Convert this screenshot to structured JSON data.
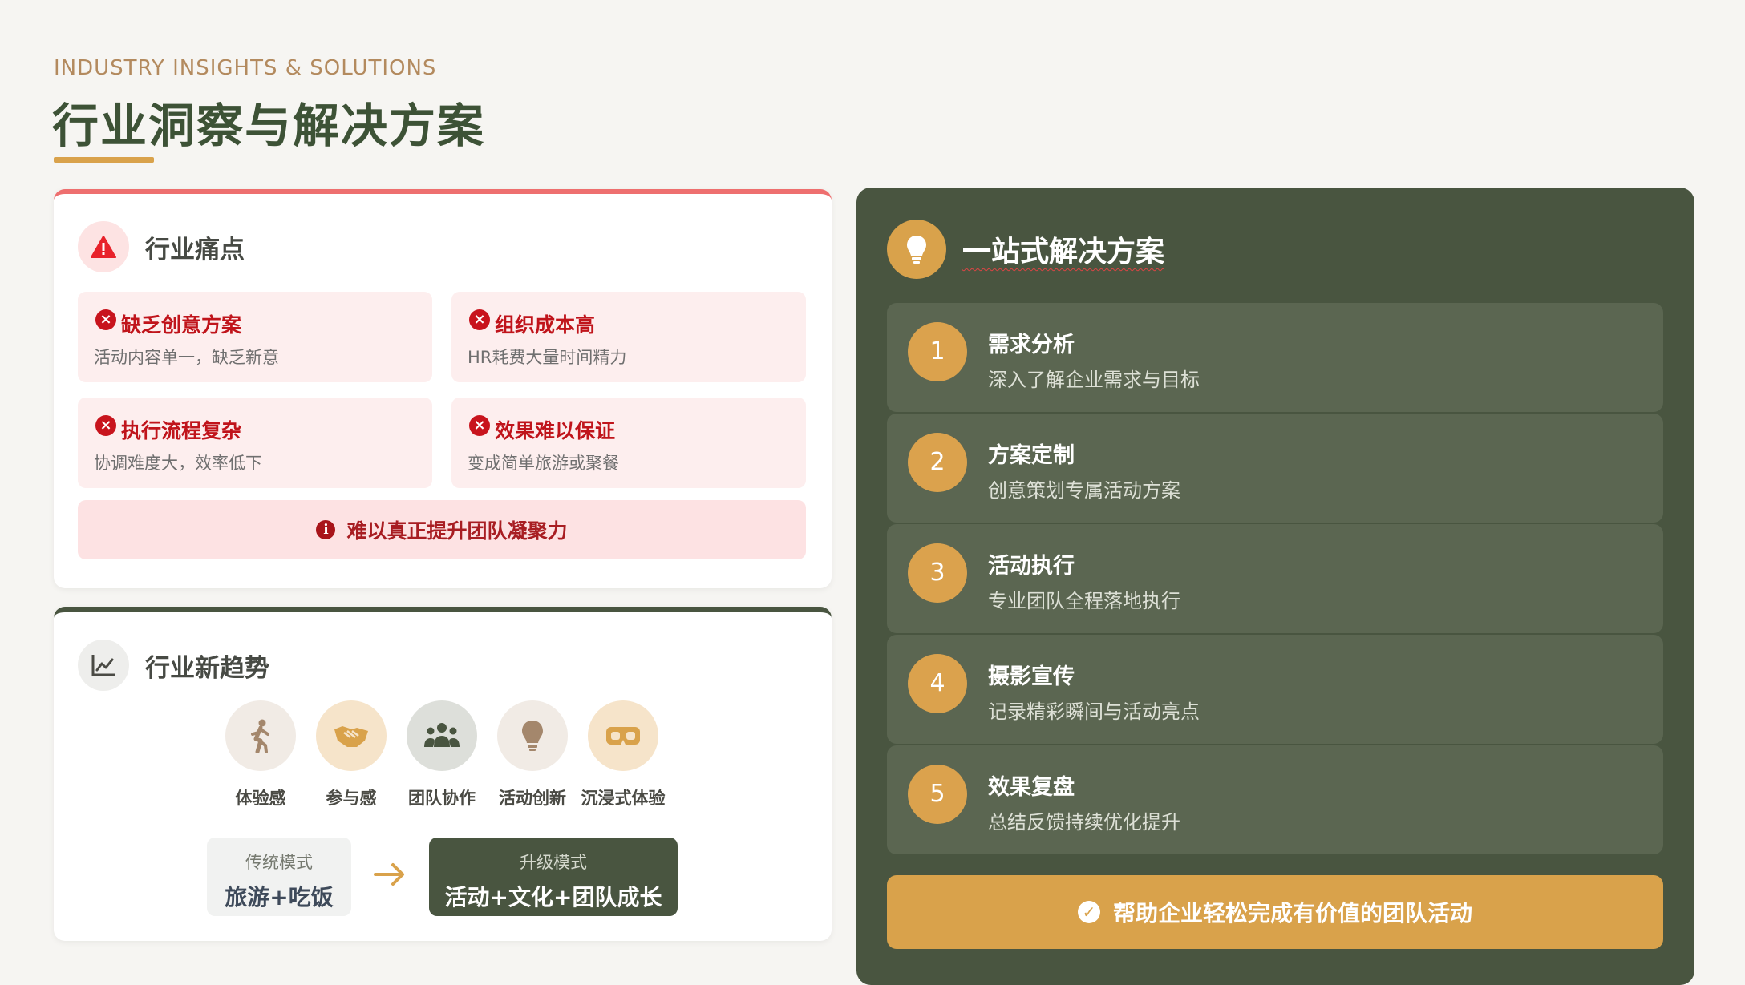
{
  "header": {
    "kicker": "INDUSTRY INSIGHTS & SOLUTIONS",
    "title": "行业洞察与解决方案"
  },
  "pain": {
    "title": "行业痛点",
    "icon": "warning-triangle-icon",
    "items": [
      {
        "title": "缺乏创意方案",
        "desc": "活动内容单一，缺乏新意"
      },
      {
        "title": "组织成本高",
        "desc": "HR耗费大量时间精力"
      },
      {
        "title": "执行流程复杂",
        "desc": "协调难度大，效率低下"
      },
      {
        "title": "效果难以保证",
        "desc": "变成简单旅游或聚餐"
      }
    ],
    "banner": "难以真正提升团队凝聚力",
    "colors": {
      "accent": "#ee6f6f",
      "text": "#c0141b",
      "bg": "#fdeeee"
    }
  },
  "trend": {
    "title": "行业新趋势",
    "icon": "line-chart-icon",
    "items": [
      {
        "label": "体验感",
        "icon": "person-walking-icon"
      },
      {
        "label": "参与感",
        "icon": "handshake-icon"
      },
      {
        "label": "团队协作",
        "icon": "people-group-icon"
      },
      {
        "label": "活动创新",
        "icon": "lightbulb-icon"
      },
      {
        "label": "沉浸式体验",
        "icon": "vr-headset-icon"
      }
    ],
    "old_mode": {
      "caption": "传统模式",
      "value": "旅游+吃饭"
    },
    "new_mode": {
      "caption": "升级模式",
      "value": "活动+文化+团队成长"
    }
  },
  "solution": {
    "title": "一站式解决方案",
    "icon": "lightbulb-icon",
    "steps": [
      {
        "num": "1",
        "title": "需求分析",
        "desc": "深入了解企业需求与目标"
      },
      {
        "num": "2",
        "title": "方案定制",
        "desc": "创意策划专属活动方案"
      },
      {
        "num": "3",
        "title": "活动执行",
        "desc": "专业团队全程落地执行"
      },
      {
        "num": "4",
        "title": "摄影宣传",
        "desc": "记录精彩瞬间与活动亮点"
      },
      {
        "num": "5",
        "title": "效果复盘",
        "desc": "总结反馈持续优化提升"
      }
    ],
    "bottom": "帮助企业轻松完成有价值的团队活动",
    "colors": {
      "panel": "#495540",
      "accent": "#d9a24b"
    }
  }
}
